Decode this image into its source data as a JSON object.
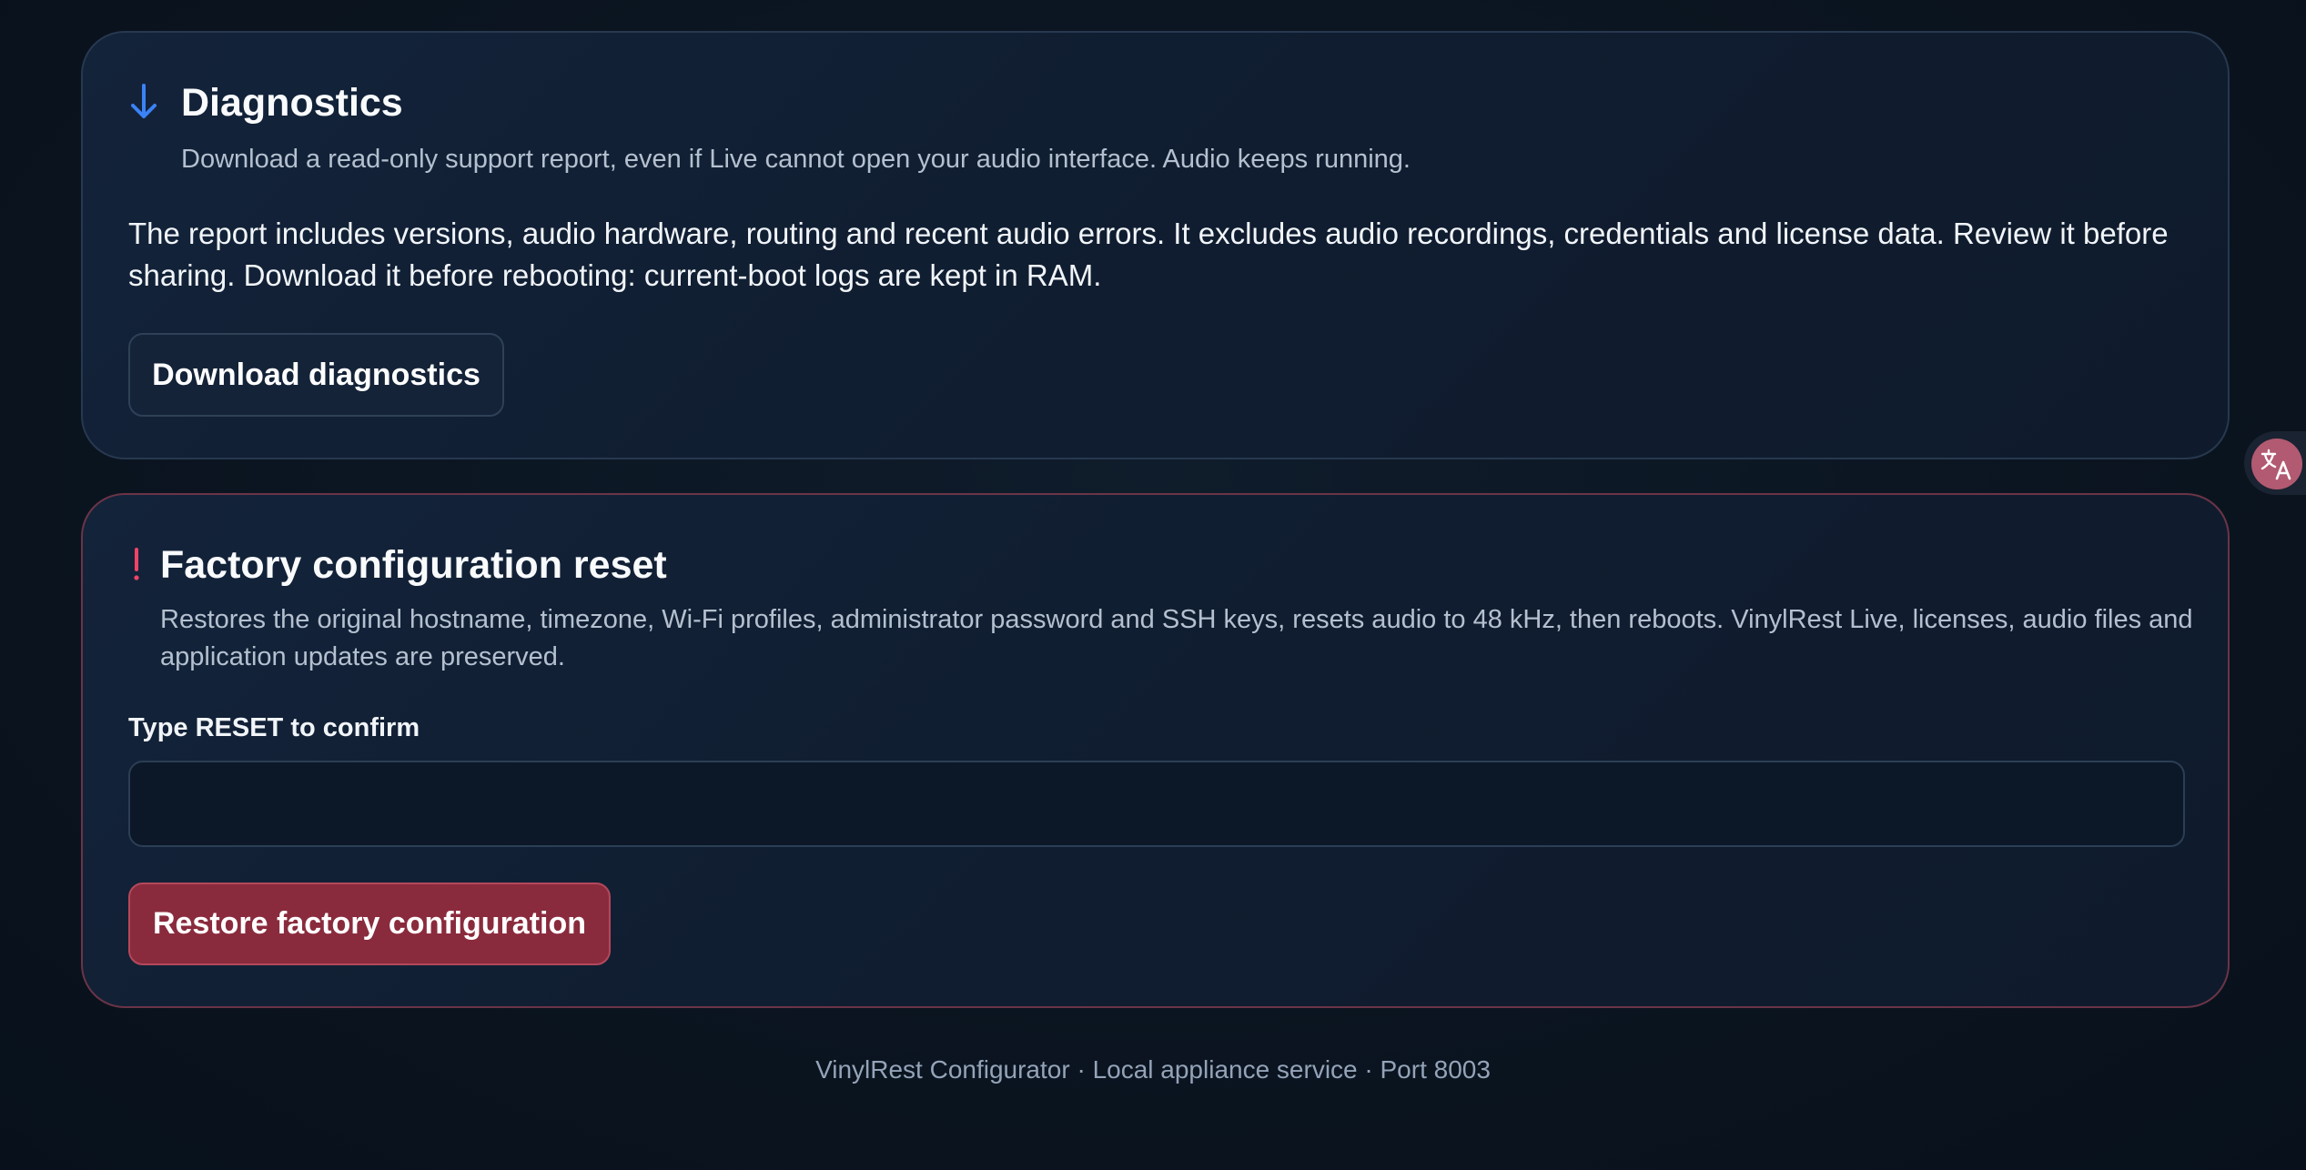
{
  "diagnostics": {
    "icon": "arrow-down-icon",
    "title": "Diagnostics",
    "subtitle": "Download a read-only support report, even if Live cannot open your audio interface. Audio keeps running.",
    "body": "The report includes versions, audio hardware, routing and recent audio errors. It excludes audio recordings, credentials and license data. Review it before sharing. Download it before rebooting: current-boot logs are kept in RAM.",
    "download_label": "Download diagnostics"
  },
  "reset": {
    "icon": "exclamation-icon",
    "title": "Factory configuration reset",
    "subtitle": "Restores the original hostname, timezone, Wi-Fi profiles, administrator password and SSH keys, resets audio to 48 kHz, then reboots. VinylRest Live, licenses, audio files and application updates are preserved.",
    "confirm_label": "Type RESET to confirm",
    "confirm_value": "",
    "restore_label": "Restore factory configuration"
  },
  "footer": {
    "text": "VinylRest Configurator · Local appliance service · Port 8003"
  },
  "colors": {
    "accent_blue": "#3b82f6",
    "danger": "#8a2b3d",
    "danger_border": "#6b3447",
    "danger_icon": "#ef4465"
  },
  "overlay": {
    "icon": "translate-icon"
  }
}
